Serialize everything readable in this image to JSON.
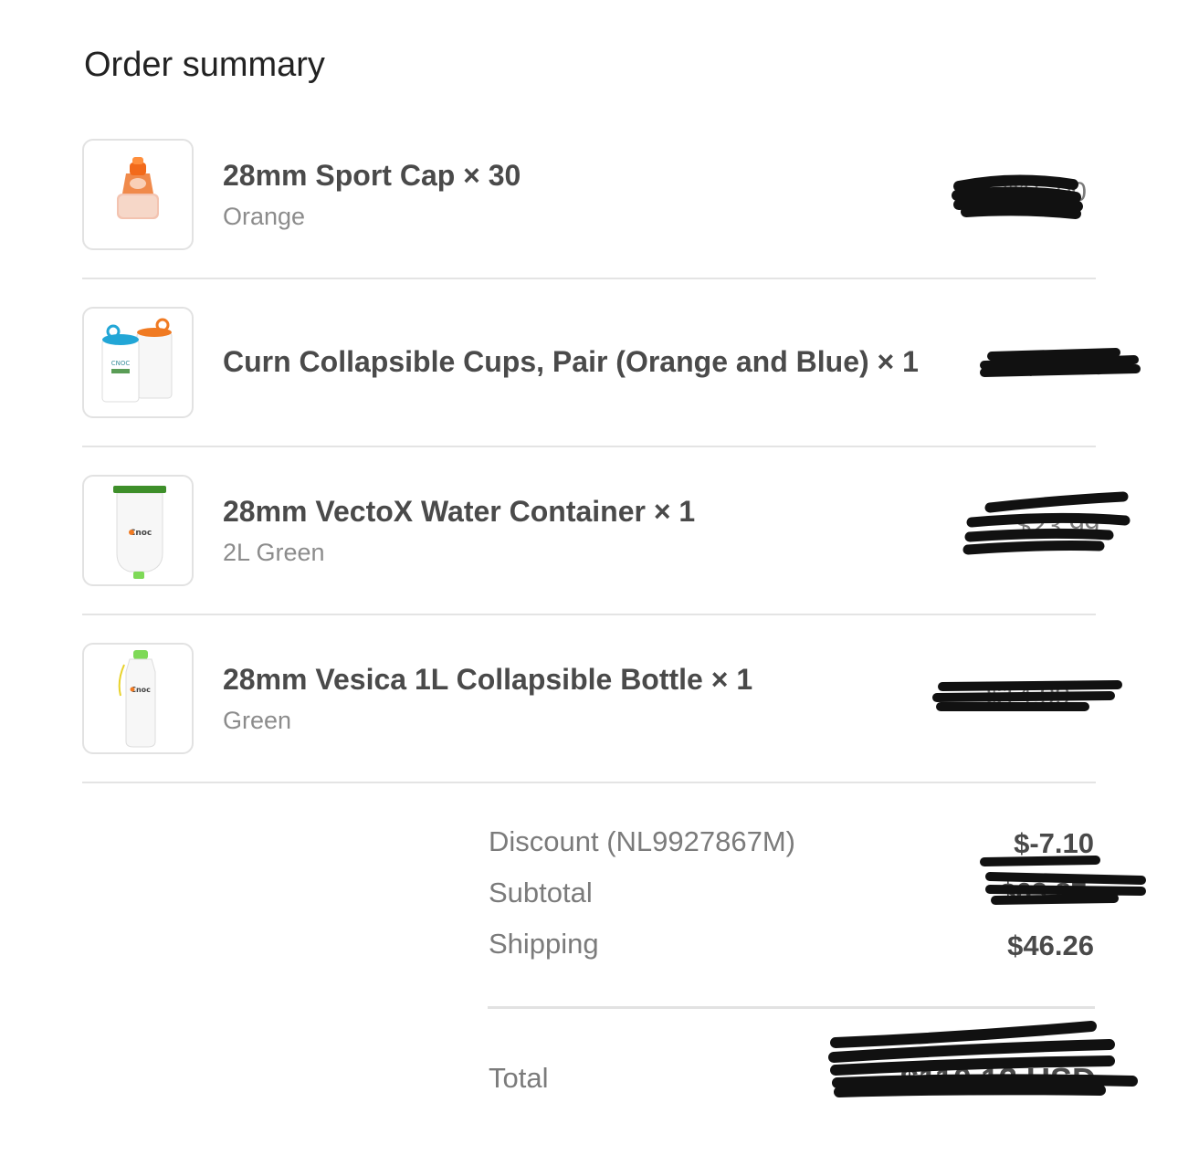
{
  "title": "Order summary",
  "items": [
    {
      "name": "28mm Sport Cap × 30",
      "variant": "Orange",
      "price": "$15.00",
      "thumb_icon": "sport-cap-icon"
    },
    {
      "name": "Curn Collapsible Cups, Pair (Orange and Blue) × 1",
      "variant": "",
      "price": "$16.99",
      "thumb_icon": "collapsible-cups-icon"
    },
    {
      "name": "28mm VectoX Water Container × 1",
      "variant": "2L Green",
      "price": "$23.99",
      "thumb_icon": "water-container-icon"
    },
    {
      "name": "28mm Vesica 1L Collapsible Bottle × 1",
      "variant": "Green",
      "price": "$14.99",
      "thumb_icon": "collapsible-bottle-icon"
    }
  ],
  "summary": {
    "discount_label": "Discount (NL9927867M)",
    "discount_value": "$-7.10",
    "subtotal_label": "Subtotal",
    "subtotal_value": "$63.87",
    "shipping_label": "Shipping",
    "shipping_value": "$46.26",
    "total_label": "Total",
    "total_value": "$110.13 USD"
  },
  "colors": {
    "title": "#222222",
    "item_name": "#4a4a4a",
    "secondary_text": "#8c8c8c",
    "divider": "#e4e4e4",
    "redaction": "#111111"
  }
}
